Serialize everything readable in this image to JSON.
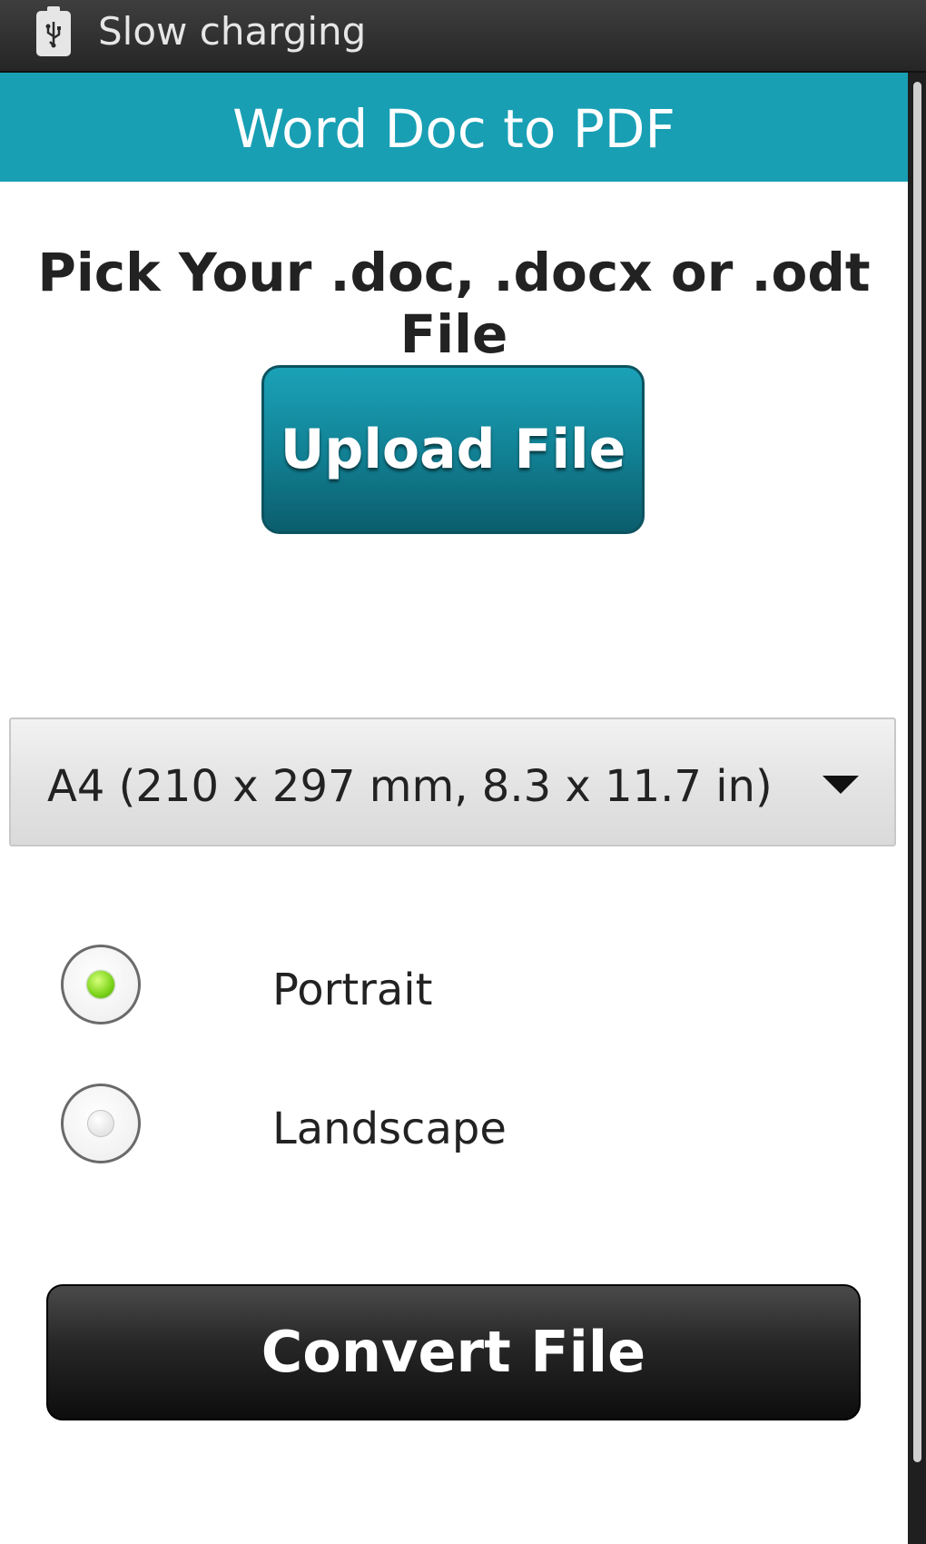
{
  "status_bar": {
    "icon": "usb-charging-icon",
    "text": "Slow charging"
  },
  "action_bar": {
    "title": "Word Doc to PDF",
    "color": "#189fb4"
  },
  "main": {
    "heading": "Pick Your .doc, .docx or .odt File",
    "upload_button_label": "Upload File",
    "page_size": {
      "selected": "A4 (210 x 297 mm, 8.3 x 11.7 in)",
      "icon": "dropdown-arrow-icon"
    },
    "orientation": {
      "options": [
        {
          "label": "Portrait",
          "selected": true
        },
        {
          "label": "Landscape",
          "selected": false
        }
      ],
      "selected_color": "#7bd319"
    },
    "convert_button_label": "Convert File"
  }
}
